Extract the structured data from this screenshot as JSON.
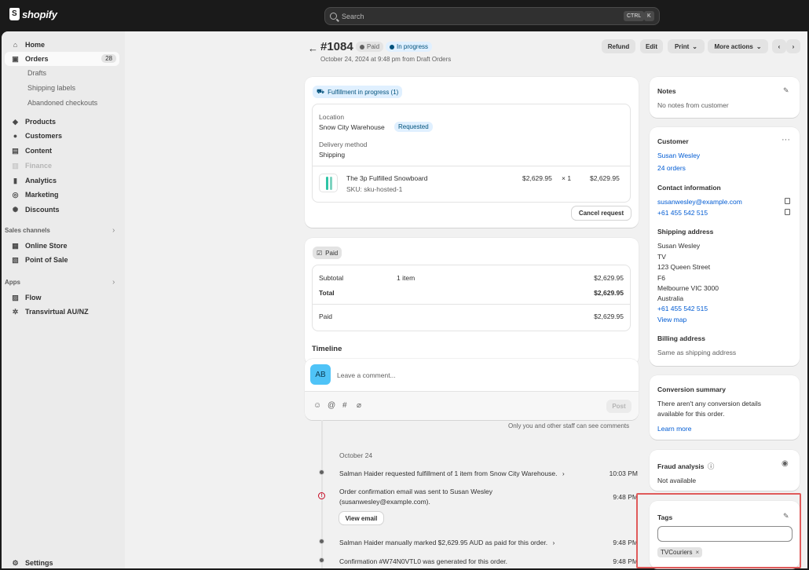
{
  "topbar": {
    "brand": "shopify",
    "search_placeholder": "Search",
    "shortcut_keys": [
      "CTRL",
      "K"
    ]
  },
  "sidebar": {
    "items": [
      {
        "label": "Home",
        "icon": "home-icon"
      },
      {
        "label": "Orders",
        "icon": "orders-icon",
        "badge": "28",
        "active": true
      },
      {
        "label": "Drafts",
        "sub": true
      },
      {
        "label": "Shipping labels",
        "sub": true
      },
      {
        "label": "Abandoned checkouts",
        "sub": true
      },
      {
        "label": "Products",
        "icon": "tag-icon"
      },
      {
        "label": "Customers",
        "icon": "person-icon"
      },
      {
        "label": "Content",
        "icon": "content-icon"
      },
      {
        "label": "Finance",
        "icon": "bank-icon",
        "disabled": true
      },
      {
        "label": "Analytics",
        "icon": "bar-chart-icon"
      },
      {
        "label": "Marketing",
        "icon": "target-icon"
      },
      {
        "label": "Discounts",
        "icon": "discount-icon"
      }
    ],
    "sales_channels_label": "Sales channels",
    "sales_channels": [
      {
        "label": "Online Store",
        "icon": "store-icon"
      },
      {
        "label": "Point of Sale",
        "icon": "pos-icon"
      }
    ],
    "apps_label": "Apps",
    "apps": [
      {
        "label": "Flow",
        "icon": "flow-icon"
      },
      {
        "label": "Transvirtual AU/NZ",
        "icon": "gear-icon"
      }
    ],
    "settings_label": "Settings"
  },
  "header": {
    "order_number": "#1084",
    "status_paid": "Paid",
    "status_progress": "In progress",
    "subtitle": "October 24, 2024 at 9:48 pm from Draft Orders",
    "actions": {
      "refund": "Refund",
      "edit": "Edit",
      "print": "Print",
      "more_actions": "More actions"
    }
  },
  "fulfillment": {
    "badge": "Fulfillment in progress (1)",
    "location_label": "Location",
    "location_value": "Snow City Warehouse",
    "location_status": "Requested",
    "delivery_label": "Delivery method",
    "delivery_value": "Shipping",
    "item_name": "The 3p Fulfilled Snowboard",
    "item_sku": "SKU: sku-hosted-1",
    "item_price": "$2,629.95",
    "item_qty": "× 1",
    "item_total": "$2,629.95",
    "cancel_button": "Cancel request"
  },
  "payment": {
    "badge": "Paid",
    "subtotal_label": "Subtotal",
    "subtotal_items": "1 item",
    "subtotal_value": "$2,629.95",
    "total_label": "Total",
    "total_value": "$2,629.95",
    "paid_label": "Paid",
    "paid_value": "$2,629.95"
  },
  "timeline": {
    "title": "Timeline",
    "avatar_initials": "AB",
    "comment_placeholder": "Leave a comment...",
    "post_button": "Post",
    "staff_note": "Only you and other staff can see comments",
    "date": "October 24",
    "events": [
      {
        "text": "Salman Haider requested fulfillment of 1 item from Snow City Warehouse.",
        "time": "10:03 PM",
        "type": "dot",
        "chevron": true
      },
      {
        "text": "Order confirmation email was sent to Susan Wesley",
        "text2": "(susanwesley@example.com).",
        "time": "9:48 PM",
        "type": "warn",
        "button": "View email"
      },
      {
        "text": "Salman Haider manually marked $2,629.95 AUD as paid for this order.",
        "time": "9:48 PM",
        "type": "dot",
        "chevron": true
      },
      {
        "text": "Confirmation #W74N0VTL0 was generated for this order.",
        "time": "9:48 PM",
        "type": "dot"
      }
    ]
  },
  "notes": {
    "title": "Notes",
    "value": "No notes from customer"
  },
  "customer": {
    "title": "Customer",
    "name": "Susan Wesley",
    "orders": "24 orders",
    "contact_title": "Contact information",
    "email": "susanwesley@example.com",
    "phone": "+61 455 542 515",
    "shipping_title": "Shipping address",
    "shipping_lines": [
      "Susan Wesley",
      "TV",
      "123 Queen Street",
      "F6",
      "Melbourne VIC 3000",
      "Australia"
    ],
    "shipping_phone": "+61 455 542 515",
    "view_map": "View map",
    "billing_title": "Billing address",
    "billing_value": "Same as shipping address"
  },
  "conversion": {
    "title": "Conversion summary",
    "line1": "There aren't any conversion details",
    "line2": "available for this order.",
    "learn_more": "Learn more"
  },
  "fraud": {
    "title": "Fraud analysis",
    "value": "Not available"
  },
  "tags": {
    "title": "Tags",
    "input_value": "",
    "chip": "TVCouriers"
  }
}
